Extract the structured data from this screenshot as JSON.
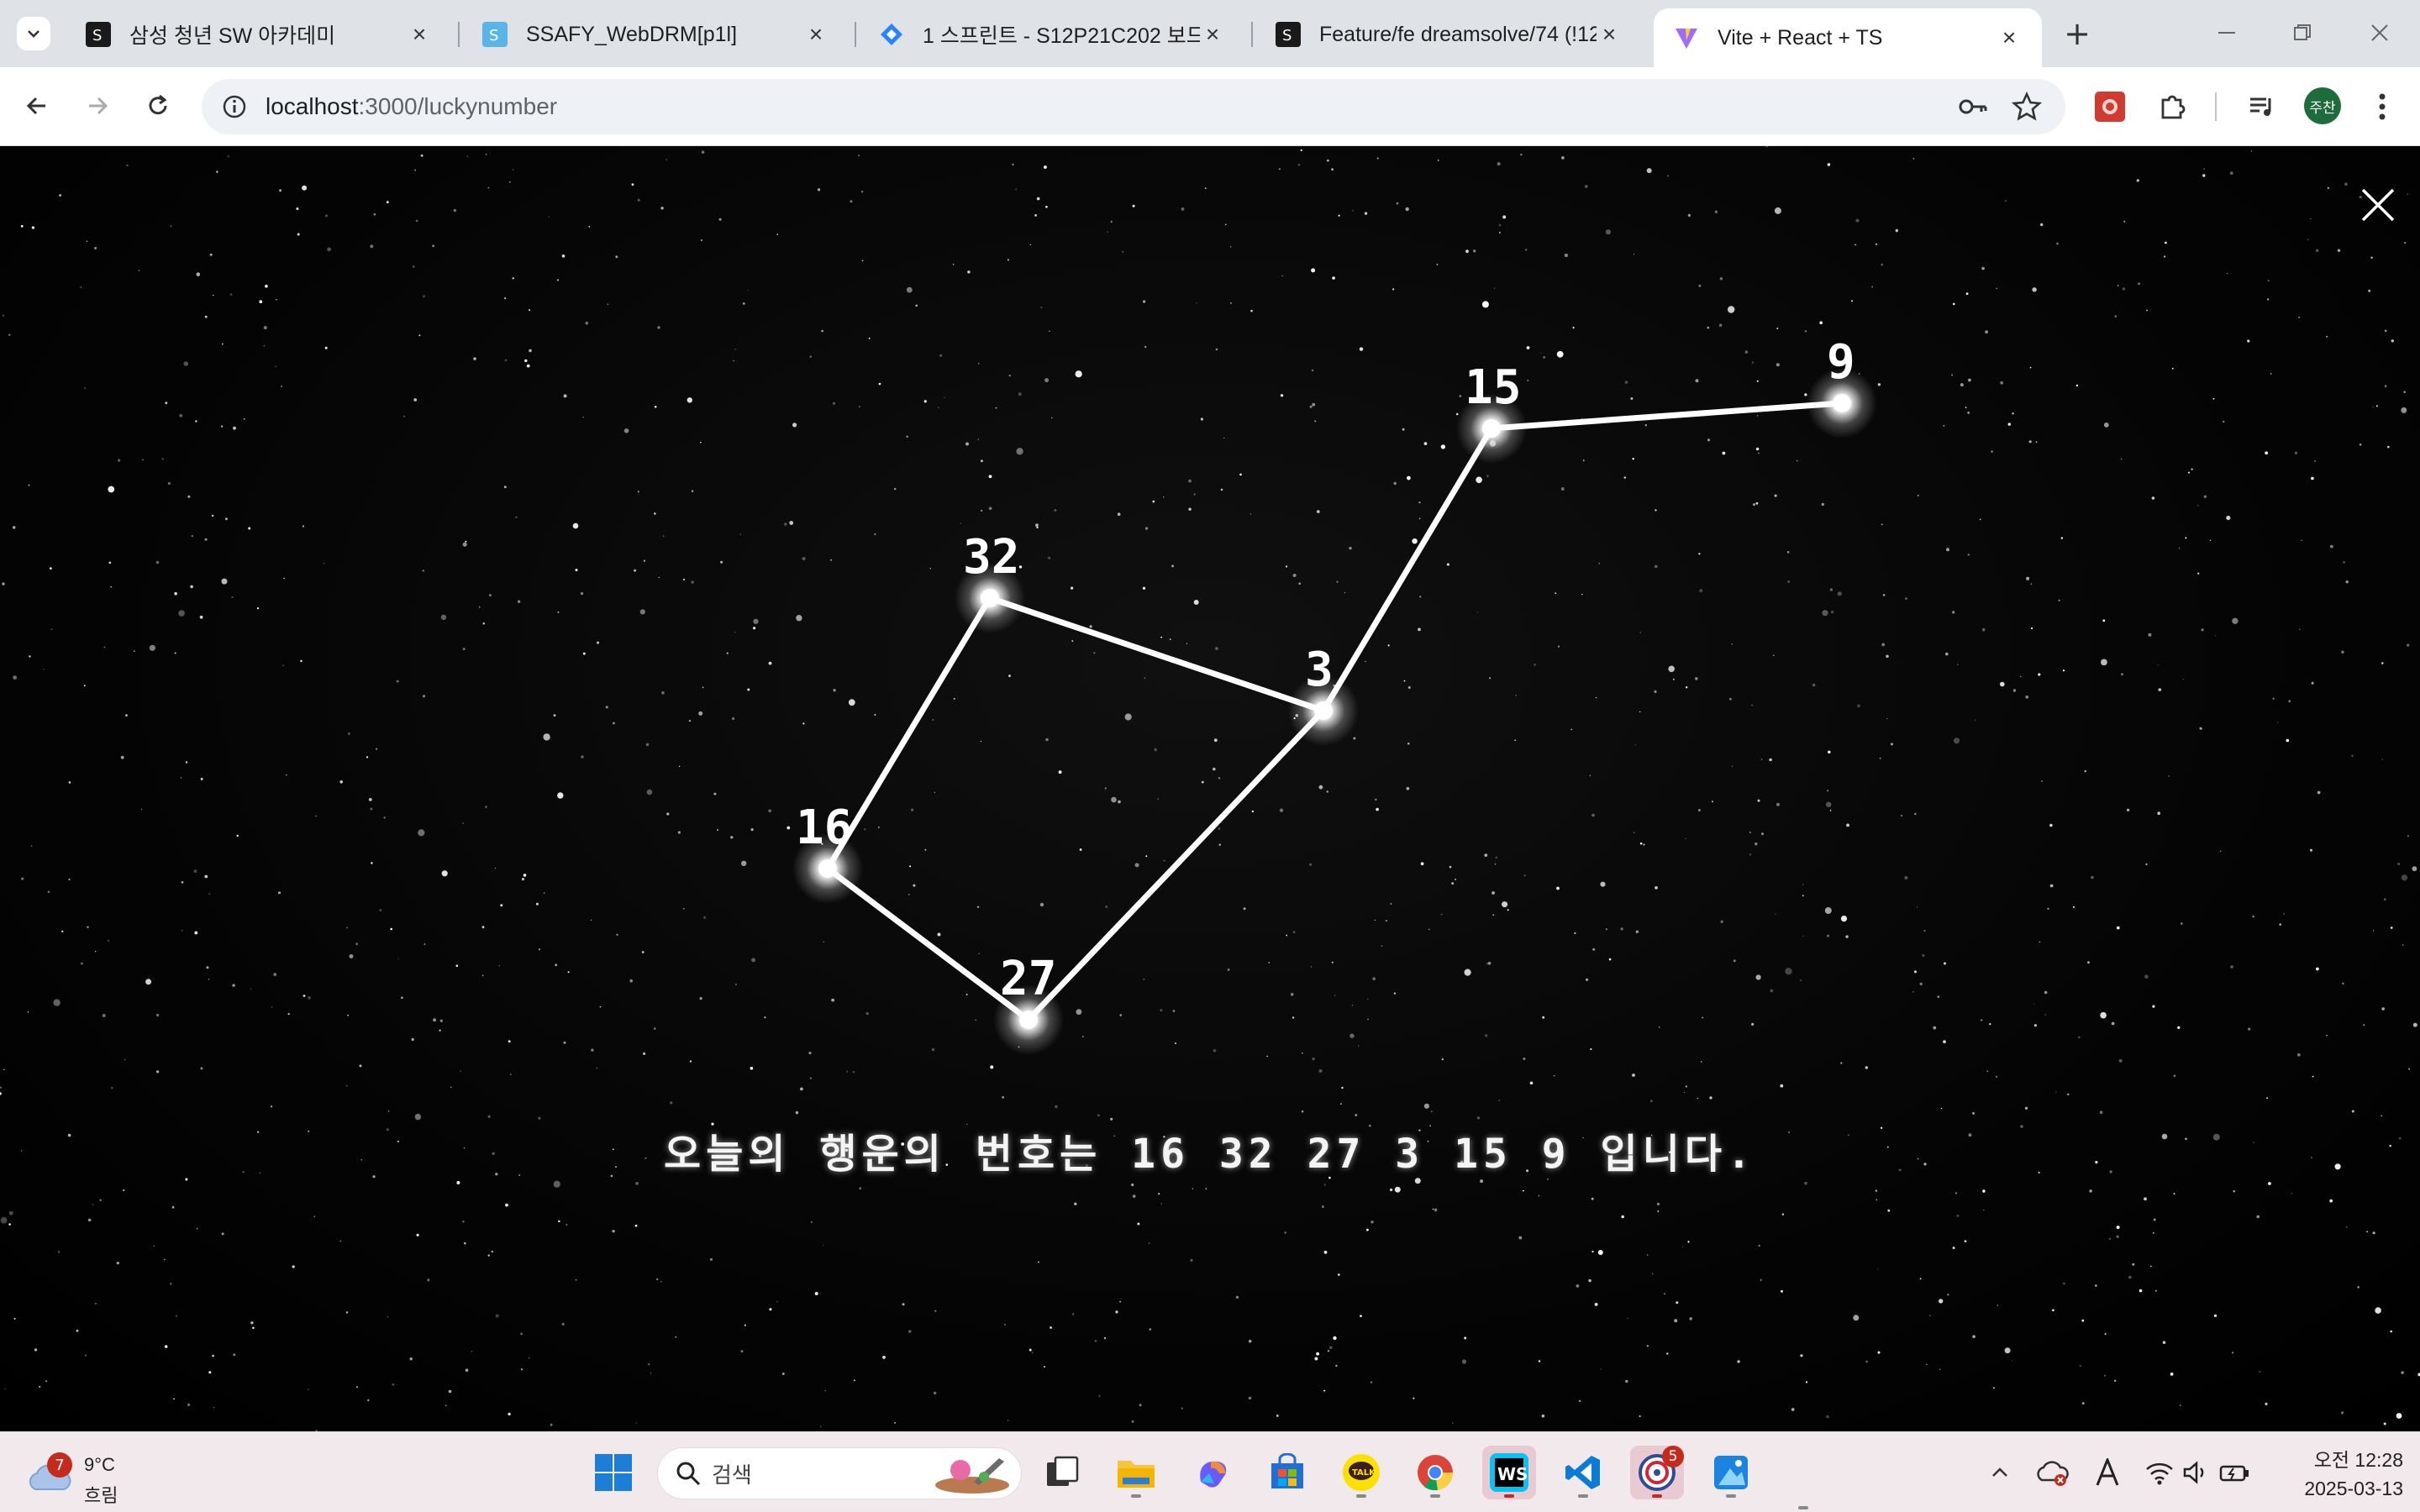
{
  "browser": {
    "tabs": [
      {
        "title": "삼성 청년 SW 아카데미",
        "active": false
      },
      {
        "title": "SSAFY_WebDRM[p1l]",
        "active": false
      },
      {
        "title": "1 스프린트 - S12P21C202 보드",
        "active": false
      },
      {
        "title": "Feature/fe dreamsolve/74 (!12",
        "active": false
      },
      {
        "title": "Vite + React + TS",
        "active": true
      }
    ],
    "new_tab_label": "+",
    "address": {
      "host": "localhost",
      "path": ":3000/luckynumber"
    },
    "profile_initials": "주찬"
  },
  "page": {
    "close_label": "✕",
    "message": "오늘의 행운의 번호는 16 32 27 3 15 9 입니다.",
    "constellation": {
      "numbers": [
        "16",
        "32",
        "27",
        "3",
        "15",
        "9"
      ],
      "path_order": [
        "16",
        "32",
        "3",
        "15",
        "9"
      ],
      "connections": [
        [
          "16",
          "32"
        ],
        [
          "32",
          "3"
        ],
        [
          "3",
          "15"
        ],
        [
          "15",
          "9"
        ],
        [
          "16",
          "27"
        ],
        [
          "27",
          "3"
        ]
      ]
    }
  },
  "taskbar": {
    "weather": {
      "temp": "9°C",
      "condition": "흐림",
      "badge": "7"
    },
    "search_placeholder": "검색",
    "app_badge": "5",
    "clock": {
      "time": "오전 12:28",
      "date": "2025-03-13"
    }
  },
  "colors": {
    "tabstrip_bg": "#dfe3e8",
    "sky_bg": "#000000",
    "constellation_line": "#ffffff",
    "taskbar_bg": "#f1e9ec"
  }
}
